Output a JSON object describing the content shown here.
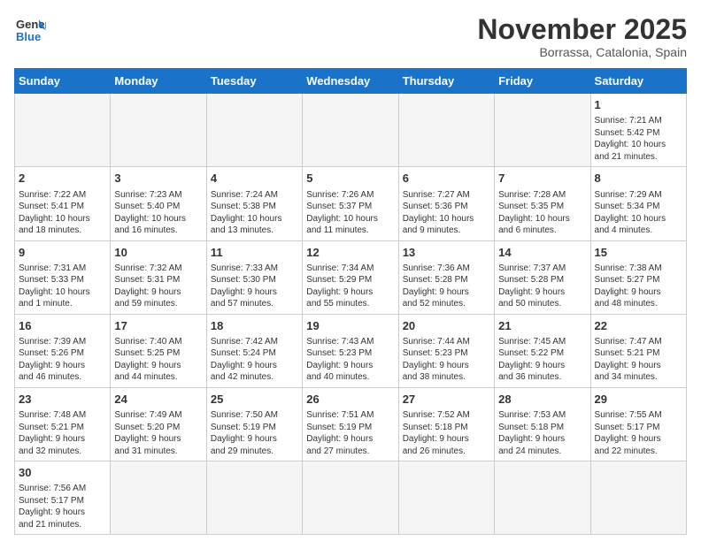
{
  "logo": {
    "text_general": "General",
    "text_blue": "Blue"
  },
  "header": {
    "title": "November 2025",
    "subtitle": "Borrassa, Catalonia, Spain"
  },
  "weekdays": [
    "Sunday",
    "Monday",
    "Tuesday",
    "Wednesday",
    "Thursday",
    "Friday",
    "Saturday"
  ],
  "weeks": [
    [
      {
        "day": "",
        "info": ""
      },
      {
        "day": "",
        "info": ""
      },
      {
        "day": "",
        "info": ""
      },
      {
        "day": "",
        "info": ""
      },
      {
        "day": "",
        "info": ""
      },
      {
        "day": "",
        "info": ""
      },
      {
        "day": "1",
        "info": "Sunrise: 7:21 AM\nSunset: 5:42 PM\nDaylight: 10 hours\nand 21 minutes."
      }
    ],
    [
      {
        "day": "2",
        "info": "Sunrise: 7:22 AM\nSunset: 5:41 PM\nDaylight: 10 hours\nand 18 minutes."
      },
      {
        "day": "3",
        "info": "Sunrise: 7:23 AM\nSunset: 5:40 PM\nDaylight: 10 hours\nand 16 minutes."
      },
      {
        "day": "4",
        "info": "Sunrise: 7:24 AM\nSunset: 5:38 PM\nDaylight: 10 hours\nand 13 minutes."
      },
      {
        "day": "5",
        "info": "Sunrise: 7:26 AM\nSunset: 5:37 PM\nDaylight: 10 hours\nand 11 minutes."
      },
      {
        "day": "6",
        "info": "Sunrise: 7:27 AM\nSunset: 5:36 PM\nDaylight: 10 hours\nand 9 minutes."
      },
      {
        "day": "7",
        "info": "Sunrise: 7:28 AM\nSunset: 5:35 PM\nDaylight: 10 hours\nand 6 minutes."
      },
      {
        "day": "8",
        "info": "Sunrise: 7:29 AM\nSunset: 5:34 PM\nDaylight: 10 hours\nand 4 minutes."
      }
    ],
    [
      {
        "day": "9",
        "info": "Sunrise: 7:31 AM\nSunset: 5:33 PM\nDaylight: 10 hours\nand 1 minute."
      },
      {
        "day": "10",
        "info": "Sunrise: 7:32 AM\nSunset: 5:31 PM\nDaylight: 9 hours\nand 59 minutes."
      },
      {
        "day": "11",
        "info": "Sunrise: 7:33 AM\nSunset: 5:30 PM\nDaylight: 9 hours\nand 57 minutes."
      },
      {
        "day": "12",
        "info": "Sunrise: 7:34 AM\nSunset: 5:29 PM\nDaylight: 9 hours\nand 55 minutes."
      },
      {
        "day": "13",
        "info": "Sunrise: 7:36 AM\nSunset: 5:28 PM\nDaylight: 9 hours\nand 52 minutes."
      },
      {
        "day": "14",
        "info": "Sunrise: 7:37 AM\nSunset: 5:28 PM\nDaylight: 9 hours\nand 50 minutes."
      },
      {
        "day": "15",
        "info": "Sunrise: 7:38 AM\nSunset: 5:27 PM\nDaylight: 9 hours\nand 48 minutes."
      }
    ],
    [
      {
        "day": "16",
        "info": "Sunrise: 7:39 AM\nSunset: 5:26 PM\nDaylight: 9 hours\nand 46 minutes."
      },
      {
        "day": "17",
        "info": "Sunrise: 7:40 AM\nSunset: 5:25 PM\nDaylight: 9 hours\nand 44 minutes."
      },
      {
        "day": "18",
        "info": "Sunrise: 7:42 AM\nSunset: 5:24 PM\nDaylight: 9 hours\nand 42 minutes."
      },
      {
        "day": "19",
        "info": "Sunrise: 7:43 AM\nSunset: 5:23 PM\nDaylight: 9 hours\nand 40 minutes."
      },
      {
        "day": "20",
        "info": "Sunrise: 7:44 AM\nSunset: 5:23 PM\nDaylight: 9 hours\nand 38 minutes."
      },
      {
        "day": "21",
        "info": "Sunrise: 7:45 AM\nSunset: 5:22 PM\nDaylight: 9 hours\nand 36 minutes."
      },
      {
        "day": "22",
        "info": "Sunrise: 7:47 AM\nSunset: 5:21 PM\nDaylight: 9 hours\nand 34 minutes."
      }
    ],
    [
      {
        "day": "23",
        "info": "Sunrise: 7:48 AM\nSunset: 5:21 PM\nDaylight: 9 hours\nand 32 minutes."
      },
      {
        "day": "24",
        "info": "Sunrise: 7:49 AM\nSunset: 5:20 PM\nDaylight: 9 hours\nand 31 minutes."
      },
      {
        "day": "25",
        "info": "Sunrise: 7:50 AM\nSunset: 5:19 PM\nDaylight: 9 hours\nand 29 minutes."
      },
      {
        "day": "26",
        "info": "Sunrise: 7:51 AM\nSunset: 5:19 PM\nDaylight: 9 hours\nand 27 minutes."
      },
      {
        "day": "27",
        "info": "Sunrise: 7:52 AM\nSunset: 5:18 PM\nDaylight: 9 hours\nand 26 minutes."
      },
      {
        "day": "28",
        "info": "Sunrise: 7:53 AM\nSunset: 5:18 PM\nDaylight: 9 hours\nand 24 minutes."
      },
      {
        "day": "29",
        "info": "Sunrise: 7:55 AM\nSunset: 5:17 PM\nDaylight: 9 hours\nand 22 minutes."
      }
    ],
    [
      {
        "day": "30",
        "info": "Sunrise: 7:56 AM\nSunset: 5:17 PM\nDaylight: 9 hours\nand 21 minutes."
      },
      {
        "day": "",
        "info": ""
      },
      {
        "day": "",
        "info": ""
      },
      {
        "day": "",
        "info": ""
      },
      {
        "day": "",
        "info": ""
      },
      {
        "day": "",
        "info": ""
      },
      {
        "day": "",
        "info": ""
      }
    ]
  ]
}
